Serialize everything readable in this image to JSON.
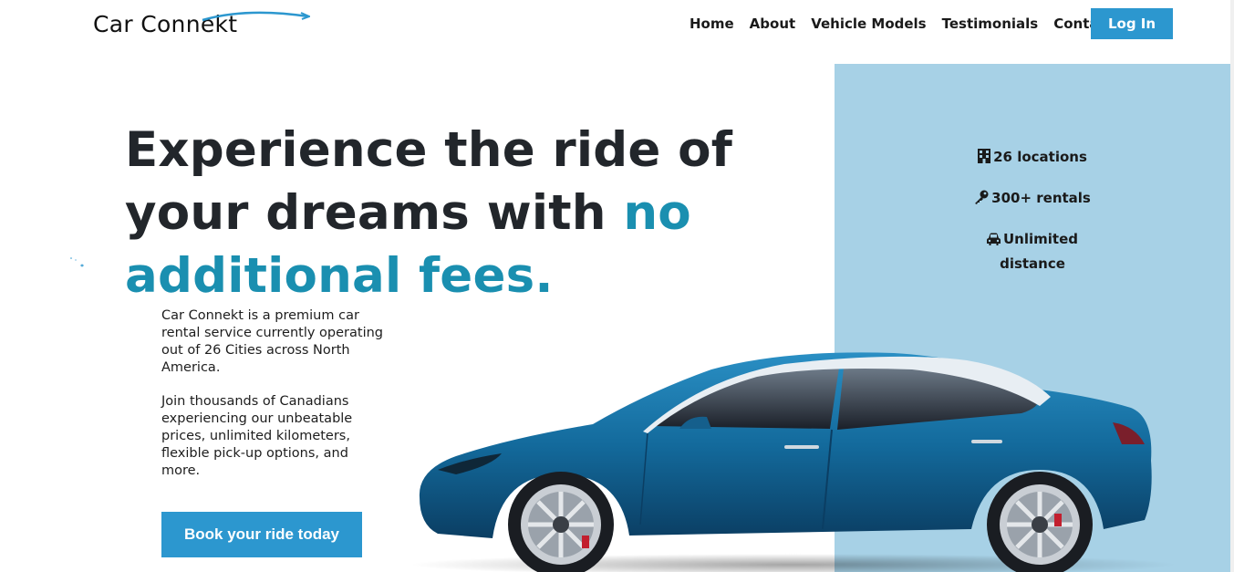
{
  "brand": {
    "name": "Car Connekt",
    "accent_color": "#2c97cf",
    "headline_accent_color": "#1a8fb0",
    "panel_color": "#a7d1e6"
  },
  "nav": {
    "items": [
      "Home",
      "About",
      "Vehicle Models",
      "Testimonials",
      "Contact"
    ],
    "login_label": "Log In"
  },
  "hero": {
    "headline_part1": "Experience the ride of your dreams with ",
    "headline_accent": "no additional fees.",
    "paragraph1": "Car Connekt is a premium car rental service currently operating out of 26 Cities across North America.",
    "paragraph2": "Join thousands of Canadians experiencing our unbeatable prices, unlimited kilometers, flexible pick-up options, and more.",
    "cta_label": "Book your ride today"
  },
  "stats": [
    {
      "icon": "building-icon",
      "text": "26 locations"
    },
    {
      "icon": "key-icon",
      "text": "300+ rentals"
    },
    {
      "icon": "car-icon",
      "text": "Unlimited distance"
    }
  ]
}
